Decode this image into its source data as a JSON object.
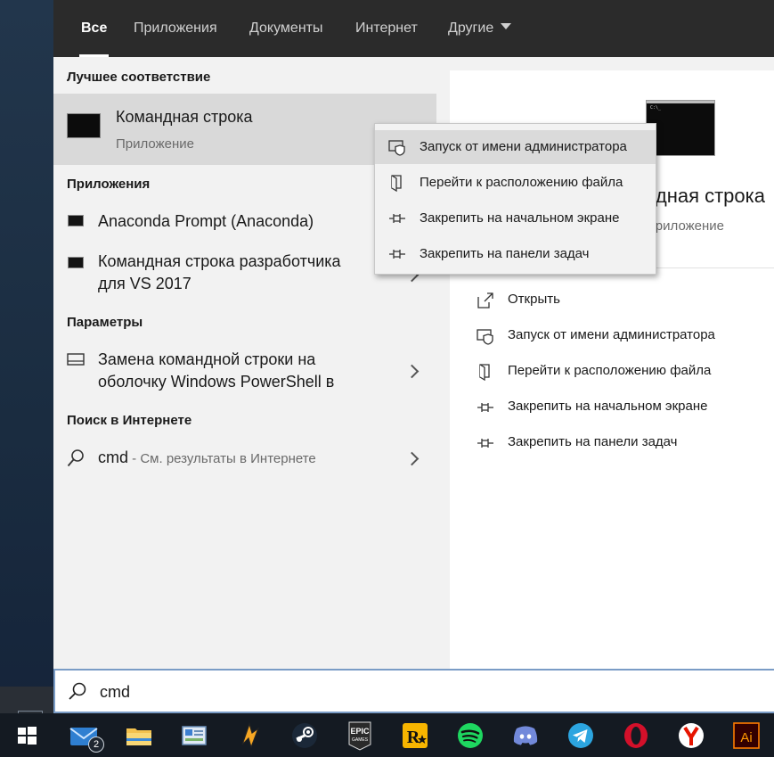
{
  "tabs": [
    {
      "label": "Все",
      "active": true
    },
    {
      "label": "Приложения"
    },
    {
      "label": "Документы"
    },
    {
      "label": "Интернет"
    },
    {
      "label": "Другие"
    }
  ],
  "results": {
    "best_match_header": "Лучшее соответствие",
    "best_match": {
      "title": "Командная строка",
      "subtitle": "Приложение",
      "icon": "cmd-icon"
    },
    "apps_header": "Приложения",
    "apps": [
      {
        "label": "Anaconda Prompt (Anaconda)",
        "icon": "anaconda-prompt-icon"
      },
      {
        "label_line1": "Командная строка разработчика",
        "label_line2": "для VS 2017",
        "icon": "vs-dev-cmd-icon"
      }
    ],
    "settings_header": "Параметры",
    "settings": [
      {
        "label_line1": "Замена командной строки на",
        "label_line2": "оболочку Windows PowerShell в",
        "icon": "settings-window-icon"
      }
    ],
    "web_header": "Поиск в Интернете",
    "web": {
      "query": "cmd",
      "hint": " - См. результаты в Интернете",
      "icon": "search-icon"
    }
  },
  "detail": {
    "title": "Командная строка",
    "subtitle": "Приложение",
    "actions": [
      {
        "label": "Открыть",
        "icon": "open-icon"
      },
      {
        "label": "Запуск от имени администратора",
        "icon": "shield-icon"
      },
      {
        "label": "Перейти к расположению файла",
        "icon": "file-location-icon"
      },
      {
        "label": "Закрепить на начальном экране",
        "icon": "pin-icon"
      },
      {
        "label": "Закрепить на панели задач",
        "icon": "pin-icon"
      }
    ]
  },
  "context_menu": [
    {
      "label": "Запуск от имени администратора",
      "icon": "shield-icon"
    },
    {
      "label": "Перейти к расположению файла",
      "icon": "file-location-icon"
    },
    {
      "label": "Закрепить на начальном экране",
      "icon": "pin-icon"
    },
    {
      "label": "Закрепить на панели задач",
      "icon": "pin-icon"
    }
  ],
  "search": {
    "value": "cmd"
  },
  "taskbar": {
    "mail_badge": "2",
    "epic_line1": "EPIC",
    "epic_line2": "GAMES",
    "illustrator_label": "Ai",
    "rockstar_label": "R",
    "apps": [
      "start-icon",
      "mail-icon",
      "file-explorer-icon",
      "control-panel-icon",
      "winamp-icon",
      "steam-icon",
      "epic-games-icon",
      "rockstar-icon",
      "spotify-icon",
      "discord-icon",
      "telegram-icon",
      "opera-icon",
      "yandex-icon",
      "illustrator-icon"
    ]
  },
  "colors": {
    "accent": "#7a9cc6",
    "tab_bar": "#2b2b2b",
    "taskbar": "#141a22",
    "pane": "#f2f2f2",
    "selected": "#d9d9d9"
  }
}
